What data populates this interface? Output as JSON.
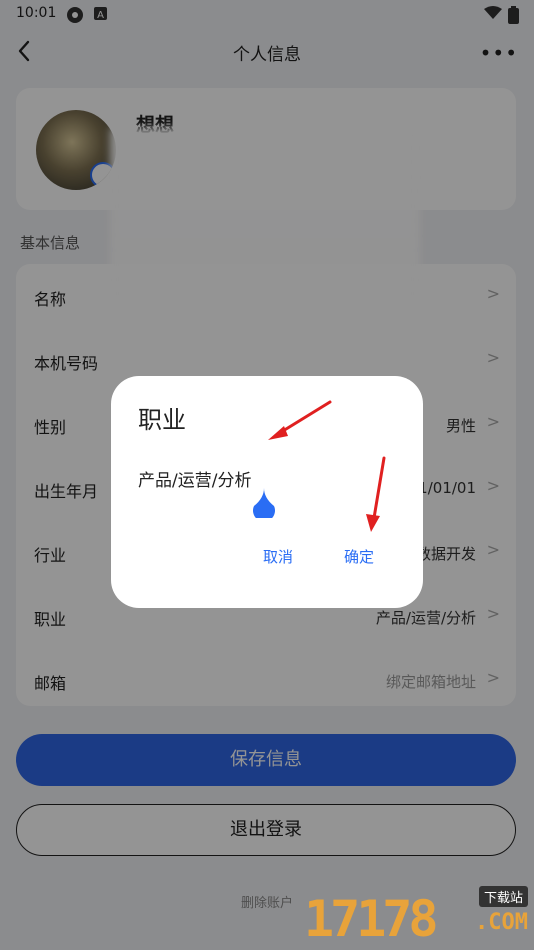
{
  "status_bar": {
    "time": "10:01"
  },
  "header": {
    "title": "个人信息"
  },
  "profile": {
    "name": "想想"
  },
  "section_basic": "基本信息",
  "rows": [
    {
      "label": "名称",
      "value": ""
    },
    {
      "label": "本机号码",
      "value": ""
    },
    {
      "label": "性别",
      "value": "男性"
    },
    {
      "label": "出生年月",
      "value": "1/01/01"
    },
    {
      "label": "行业",
      "value": "数据开发"
    },
    {
      "label": "职业",
      "value": "产品/运营/分析"
    },
    {
      "label": "邮箱",
      "value": "绑定邮箱地址"
    }
  ],
  "buttons": {
    "save": "保存信息",
    "logout": "退出登录",
    "delete": "删除账户"
  },
  "dialog": {
    "title": "职业",
    "value": "产品/运营/分析",
    "cancel": "取消",
    "confirm": "确定"
  },
  "watermark": {
    "number": "17178",
    "download": "下载站",
    "domain": ".COM"
  },
  "colors": {
    "accent": "#2a6df4",
    "save_button": "#2f66e5",
    "arrow": "#e02020"
  }
}
